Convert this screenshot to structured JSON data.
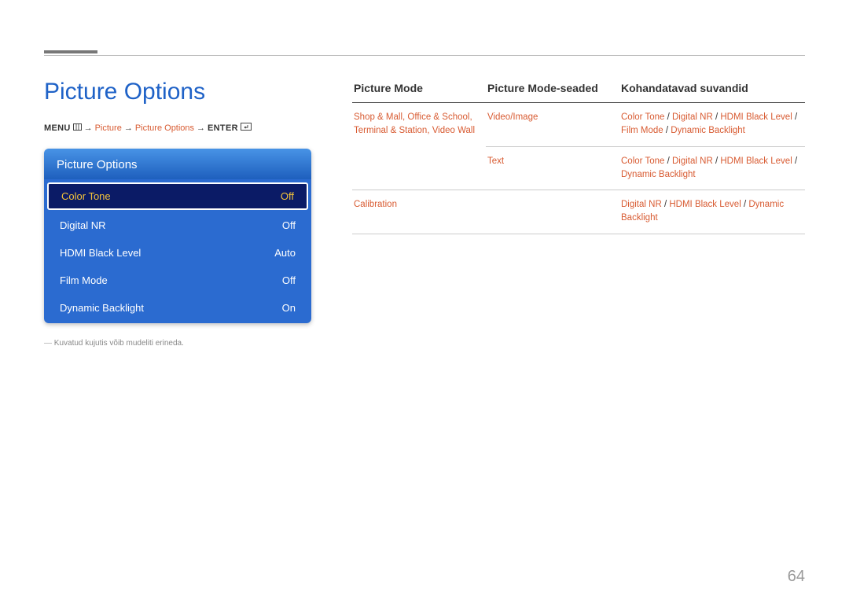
{
  "page_title": "Picture Options",
  "breadcrumb": {
    "menu_label": "MENU",
    "arrow": "→",
    "picture": "Picture",
    "picture_options": "Picture Options",
    "enter_label": "ENTER"
  },
  "menu": {
    "header": "Picture Options",
    "items": [
      {
        "label": "Color Tone",
        "value": "Off",
        "selected": true
      },
      {
        "label": "Digital NR",
        "value": "Off",
        "selected": false
      },
      {
        "label": "HDMI Black Level",
        "value": "Auto",
        "selected": false
      },
      {
        "label": "Film Mode",
        "value": "Off",
        "selected": false
      },
      {
        "label": "Dynamic Backlight",
        "value": "On",
        "selected": false
      }
    ]
  },
  "footnote": "Kuvatud kujutis võib mudeliti erineda.",
  "table": {
    "headers": {
      "col1": "Picture Mode",
      "col2": "Picture Mode-seaded",
      "col3": "Kohandatavad suvandid"
    },
    "rows": [
      {
        "mode": "Shop & Mall, Office & School, Terminal & Station, Video Wall",
        "setting": "Video/Image",
        "options": "Color Tone / Digital NR / HDMI Black Level / Film Mode / Dynamic Backlight"
      },
      {
        "mode": "",
        "setting": "Text",
        "options": "Color Tone / Digital NR / HDMI Black Level / Dynamic Backlight"
      },
      {
        "mode": "Calibration",
        "setting": "",
        "options": "Digital NR / HDMI Black Level / Dynamic Backlight"
      }
    ]
  },
  "page_number": "64"
}
